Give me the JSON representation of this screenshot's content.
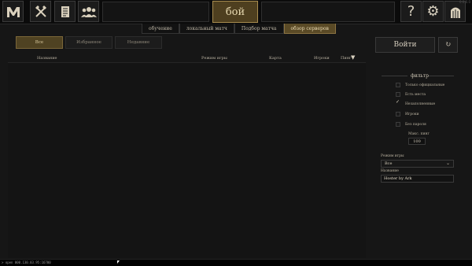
{
  "topbar": {
    "icons": [
      "game-logo-icon",
      "crossed-axes-icon",
      "scroll-icon",
      "group-icon"
    ],
    "fight_label": "бой",
    "right_icons": [
      "help-icon",
      "gear-icon",
      "exit-door-icon"
    ],
    "version": "0.0.0.0"
  },
  "subtabs": [
    {
      "label": "обучение",
      "active": false
    },
    {
      "label": "локальный матч",
      "active": false
    },
    {
      "label": "Подбор матча",
      "active": false
    },
    {
      "label": "обзор серверов",
      "active": true
    }
  ],
  "filter_tabs": [
    {
      "label": "Все",
      "active": true
    },
    {
      "label": "Избранное",
      "active": false
    },
    {
      "label": "Недавние",
      "active": false
    }
  ],
  "columns": {
    "name": "Название",
    "mode": "Режим игры",
    "map": "Карта",
    "players": "Игроки",
    "ping": "Пинг"
  },
  "sort_icon": "sort-down-icon",
  "buttons": {
    "join": "Войти",
    "refresh_icon": "refresh-icon"
  },
  "filter": {
    "title": "фильтр",
    "checkboxes": [
      {
        "label": "Только официальные",
        "checked": false
      },
      {
        "label": "Есть места",
        "checked": false
      },
      {
        "label": "Незаполненные",
        "checked": true
      },
      {
        "label": "Игроки",
        "checked": false
      },
      {
        "label": "Без пароля",
        "checked": false
      }
    ],
    "max_ping_label": "Макс. пинг",
    "max_ping_value": "100",
    "mode_label": "Режим игры",
    "mode_value": "Все",
    "name_label": "Название",
    "name_value": "Hoster by Ark"
  },
  "statusbar": {
    "text": "> open 000.130.83.95:16700"
  }
}
